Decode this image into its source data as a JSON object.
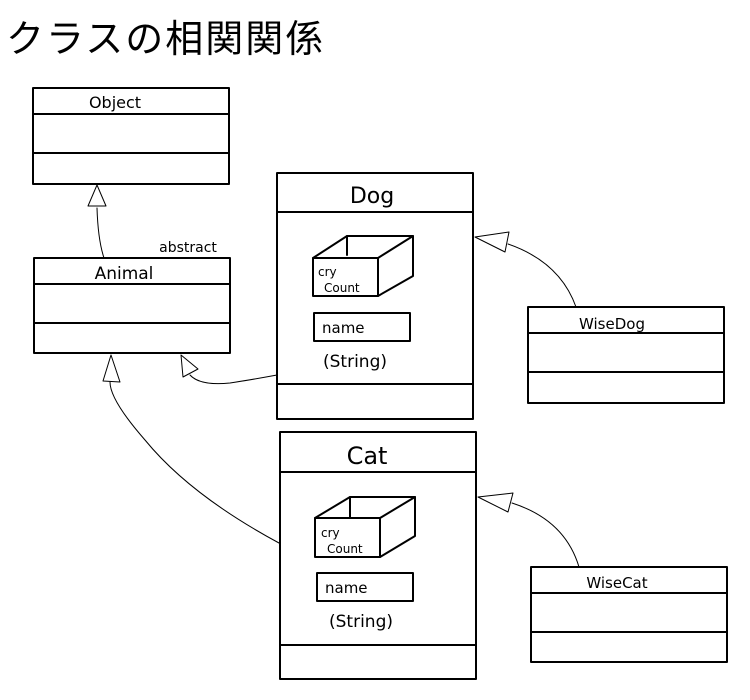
{
  "title": "クラスの相関関係",
  "classes": {
    "object": {
      "name": "Object",
      "stereotype": ""
    },
    "animal": {
      "name": "Animal",
      "stereotype": "abstract"
    },
    "dog": {
      "name": "Dog",
      "fields": [
        {
          "label_line1": "cry",
          "label_line2": "Count",
          "kind": "box"
        },
        {
          "label": "name",
          "type": "(String)",
          "kind": "field"
        }
      ]
    },
    "cat": {
      "name": "Cat",
      "fields": [
        {
          "label_line1": "cry",
          "label_line2": "Count",
          "kind": "box"
        },
        {
          "label": "name",
          "type": "(String)",
          "kind": "field"
        }
      ]
    },
    "wisedog": {
      "name": "WiseDog"
    },
    "wisecat": {
      "name": "WiseCat"
    }
  },
  "relations": [
    {
      "from": "Animal",
      "to": "Object",
      "type": "inheritance"
    },
    {
      "from": "Dog",
      "to": "Animal",
      "type": "inheritance"
    },
    {
      "from": "Cat",
      "to": "Animal",
      "type": "inheritance"
    },
    {
      "from": "WiseDog",
      "to": "Dog",
      "type": "inheritance"
    },
    {
      "from": "WiseCat",
      "to": "Cat",
      "type": "inheritance"
    }
  ],
  "colors": {
    "ink": "#000000",
    "background": "#ffffff"
  }
}
